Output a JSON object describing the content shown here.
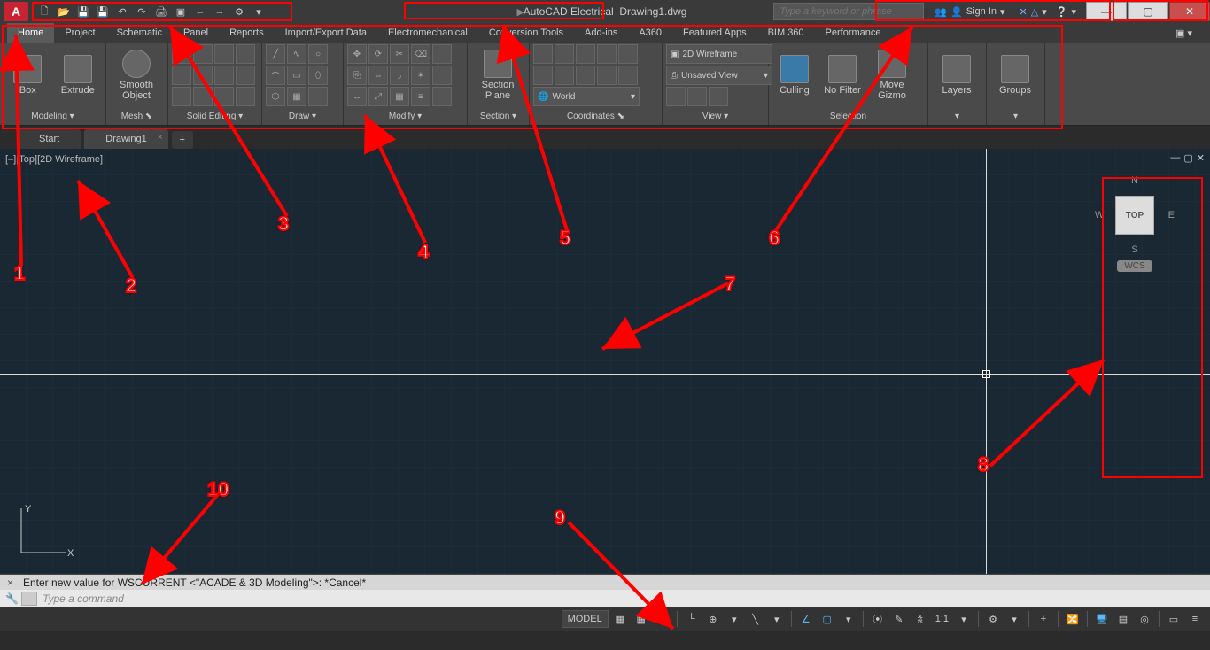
{
  "title": {
    "app": "AutoCAD Electrical",
    "file": "Drawing1.dwg"
  },
  "search": {
    "placeholder": "Type a keyword or phrase"
  },
  "signin": {
    "label": "Sign In"
  },
  "menu": [
    "Home",
    "Project",
    "Schematic",
    "Panel",
    "Reports",
    "Import/Export Data",
    "Electromechanical",
    "Conversion Tools",
    "Add-ins",
    "A360",
    "Featured Apps",
    "BIM 360",
    "Performance"
  ],
  "ribbon": {
    "modeling": {
      "title": "Modeling",
      "btns": [
        "Box",
        "Extrude"
      ]
    },
    "mesh": {
      "title": "Mesh",
      "btn": "Smooth\nObject"
    },
    "solidedit": {
      "title": "Solid Editing"
    },
    "draw": {
      "title": "Draw"
    },
    "modify": {
      "title": "Modify"
    },
    "section": {
      "title": "Section",
      "btn": "Section\nPlane"
    },
    "coords": {
      "title": "Coordinates",
      "world": "World"
    },
    "view": {
      "title": "View",
      "style": "2D Wireframe",
      "saved": "Unsaved View"
    },
    "selection": {
      "title": "Selection",
      "culling": "Culling",
      "nofilter": "No Filter",
      "gizmo": "Move\nGizmo"
    },
    "layers": {
      "title": "Layers"
    },
    "groups": {
      "title": "Groups"
    }
  },
  "tabs": {
    "start": "Start",
    "drawing": "Drawing1"
  },
  "viewport": {
    "controls": "[–][Top][2D Wireframe]",
    "cube": "TOP",
    "n": "N",
    "s": "S",
    "e": "E",
    "w": "W",
    "wcs": "WCS",
    "y": "Y",
    "x": "X"
  },
  "cmd": {
    "history": "Enter new value for WSCURRENT <\"ACADE & 3D Modeling\">: *Cancel*",
    "prompt": "Type a command"
  },
  "status": {
    "model": "MODEL",
    "scale": "1:1"
  },
  "callouts": [
    "1",
    "2",
    "3",
    "4",
    "5",
    "6",
    "7",
    "8",
    "9",
    "10"
  ]
}
